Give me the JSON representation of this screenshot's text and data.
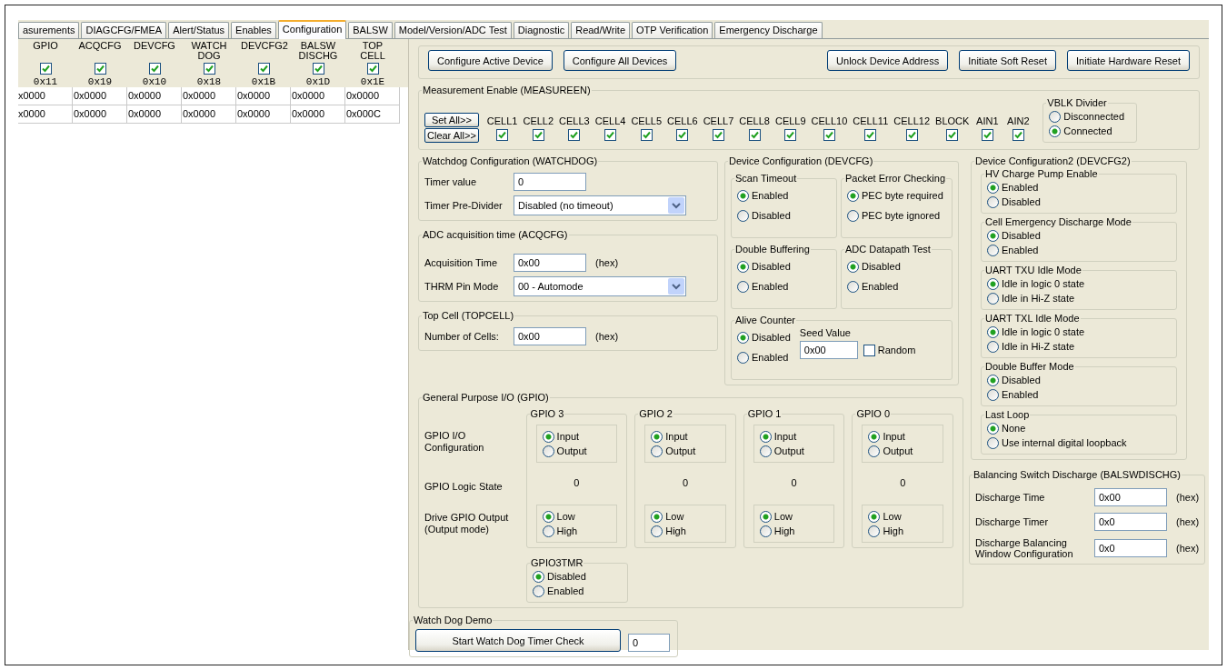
{
  "tabs": [
    {
      "label": "asurements",
      "selected": false
    },
    {
      "label": "DIAGCFG/FMEA",
      "selected": false
    },
    {
      "label": "Alert/Status",
      "selected": false
    },
    {
      "label": "Enables",
      "selected": false
    },
    {
      "label": "Configuration",
      "selected": true
    },
    {
      "label": "BALSW",
      "selected": false
    },
    {
      "label": "Model/Version/ADC Test",
      "selected": false
    },
    {
      "label": "Diagnostic",
      "selected": false
    },
    {
      "label": "Read/Write",
      "selected": false
    },
    {
      "label": "OTP Verification",
      "selected": false
    },
    {
      "label": "Emergency Discharge",
      "selected": false
    }
  ],
  "register_table": {
    "columns": [
      {
        "name": "GPIO",
        "checked": true,
        "address": "0x11"
      },
      {
        "name": "ACQCFG",
        "checked": true,
        "address": "0x19"
      },
      {
        "name": "DEVCFG",
        "checked": true,
        "address": "0x10"
      },
      {
        "name": "WATCH DOG",
        "checked": true,
        "address": "0x18"
      },
      {
        "name": "DEVCFG2",
        "checked": true,
        "address": "0x1B"
      },
      {
        "name": "BALSW DISCHG",
        "checked": true,
        "address": "0x1D"
      },
      {
        "name": "TOP CELL",
        "checked": true,
        "address": "0x1E"
      }
    ],
    "rows": [
      [
        "x0000",
        "0x0000",
        "0x0000",
        "0x0000",
        "0x0000",
        "0x0000",
        "0x0000"
      ],
      [
        "x0000",
        "0x0000",
        "0x0000",
        "0x0000",
        "0x0000",
        "0x0000",
        "0x000C"
      ]
    ]
  },
  "buttons": [
    "Configure Active Device",
    "Configure All Devices",
    "Unlock Device Address",
    "Initiate Soft Reset",
    "Initiate Hardware Reset"
  ],
  "measurement_enable": {
    "title": "Measurement Enable (MEASUREEN)",
    "set_all": "Set All>>",
    "clear_all": "Clear All>>",
    "channels": [
      {
        "label": "CELL1",
        "checked": true
      },
      {
        "label": "CELL2",
        "checked": true
      },
      {
        "label": "CELL3",
        "checked": true
      },
      {
        "label": "CELL4",
        "checked": true
      },
      {
        "label": "CELL5",
        "checked": true
      },
      {
        "label": "CELL6",
        "checked": true
      },
      {
        "label": "CELL7",
        "checked": true
      },
      {
        "label": "CELL8",
        "checked": true
      },
      {
        "label": "CELL9",
        "checked": true
      },
      {
        "label": "CELL10",
        "checked": true
      },
      {
        "label": "CELL11",
        "checked": true
      },
      {
        "label": "CELL12",
        "checked": true
      },
      {
        "label": "BLOCK",
        "checked": true
      },
      {
        "label": "AIN1",
        "checked": true
      },
      {
        "label": "AIN2",
        "checked": true
      }
    ],
    "vblk_divider": {
      "title": "VBLK Divider",
      "options": [
        {
          "label": "Disconnected",
          "selected": false
        },
        {
          "label": "Connected",
          "selected": true
        }
      ]
    }
  },
  "watchdog": {
    "title": "Watchdog Configuration (WATCHDOG)",
    "fields": [
      {
        "kind": "text",
        "label": "Timer value",
        "value": "0"
      },
      {
        "kind": "select",
        "label": "Timer Pre-Divider",
        "value": "Disabled (no timeout)"
      }
    ]
  },
  "acqcfg": {
    "title": "ADC acquisition time (ACQCFG)",
    "fields": [
      {
        "kind": "text",
        "label": "Acquisition Time",
        "value": "0x00",
        "unit": "(hex)"
      },
      {
        "kind": "select",
        "label": "THRM Pin Mode",
        "value": "00 - Automode"
      }
    ]
  },
  "topcell": {
    "title": "Top Cell (TOPCELL)",
    "fields": [
      {
        "kind": "text",
        "label": "Number of Cells:",
        "value": "0x00",
        "unit": "(hex)"
      }
    ]
  },
  "devcfg": {
    "title": "Device Configuration (DEVCFG)",
    "groups": [
      {
        "title": "Scan Timeout",
        "options": [
          {
            "label": "Enabled",
            "selected": true
          },
          {
            "label": "Disabled",
            "selected": false
          }
        ]
      },
      {
        "title": "Packet Error Checking",
        "options": [
          {
            "label": "PEC byte required",
            "selected": true
          },
          {
            "label": "PEC byte ignored",
            "selected": false
          }
        ]
      },
      {
        "title": "Double Buffering",
        "options": [
          {
            "label": "Disabled",
            "selected": true
          },
          {
            "label": "Enabled",
            "selected": false
          }
        ]
      },
      {
        "title": "ADC Datapath Test",
        "options": [
          {
            "label": "Disabled",
            "selected": true
          },
          {
            "label": "Enabled",
            "selected": false
          }
        ]
      }
    ],
    "alive_counter": {
      "title": "Alive Counter",
      "options": [
        {
          "label": "Disabled",
          "selected": true
        },
        {
          "label": "Enabled",
          "selected": false
        }
      ],
      "seed_label": "Seed Value",
      "seed_value": "0x00",
      "random": {
        "label": "Random",
        "checked": false
      }
    }
  },
  "devcfg2": {
    "title": "Device Configuration2 (DEVCFG2)",
    "groups": [
      {
        "title": "HV Charge Pump Enable",
        "options": [
          {
            "label": "Enabled",
            "selected": true
          },
          {
            "label": "Disabled",
            "selected": false
          }
        ]
      },
      {
        "title": "Cell Emergency Discharge Mode",
        "options": [
          {
            "label": "Disabled",
            "selected": true
          },
          {
            "label": "Enabled",
            "selected": false
          }
        ]
      },
      {
        "title": "UART TXU Idle Mode",
        "options": [
          {
            "label": "Idle in logic 0 state",
            "selected": true
          },
          {
            "label": "Idle in Hi-Z state",
            "selected": false
          }
        ]
      },
      {
        "title": "UART TXL Idle Mode",
        "options": [
          {
            "label": "Idle in logic 0 state",
            "selected": true
          },
          {
            "label": "Idle in Hi-Z state",
            "selected": false
          }
        ]
      },
      {
        "title": "Double Buffer Mode",
        "options": [
          {
            "label": "Disabled",
            "selected": true
          },
          {
            "label": "Enabled",
            "selected": false
          }
        ]
      },
      {
        "title": "Last Loop",
        "options": [
          {
            "label": "None",
            "selected": true
          },
          {
            "label": "Use internal digital loopback",
            "selected": false
          }
        ]
      }
    ]
  },
  "gpio": {
    "title": "General Purpose I/O (GPIO)",
    "row_labels": [
      "GPIO I/O Configuration",
      "GPIO Logic State",
      "Drive GPIO Output (Output mode)"
    ],
    "pins": [
      {
        "title": "GPIO 3",
        "io": [
          {
            "label": "Input",
            "selected": true
          },
          {
            "label": "Output",
            "selected": false
          }
        ],
        "logic_state": "0",
        "drive": [
          {
            "label": "Low",
            "selected": true
          },
          {
            "label": "High",
            "selected": false
          }
        ]
      },
      {
        "title": "GPIO 2",
        "io": [
          {
            "label": "Input",
            "selected": true
          },
          {
            "label": "Output",
            "selected": false
          }
        ],
        "logic_state": "0",
        "drive": [
          {
            "label": "Low",
            "selected": true
          },
          {
            "label": "High",
            "selected": false
          }
        ]
      },
      {
        "title": "GPIO 1",
        "io": [
          {
            "label": "Input",
            "selected": true
          },
          {
            "label": "Output",
            "selected": false
          }
        ],
        "logic_state": "0",
        "drive": [
          {
            "label": "Low",
            "selected": true
          },
          {
            "label": "High",
            "selected": false
          }
        ]
      },
      {
        "title": "GPIO 0",
        "io": [
          {
            "label": "Input",
            "selected": true
          },
          {
            "label": "Output",
            "selected": false
          }
        ],
        "logic_state": "0",
        "drive": [
          {
            "label": "Low",
            "selected": true
          },
          {
            "label": "High",
            "selected": false
          }
        ]
      }
    ],
    "gpio3tmr": {
      "title": "GPIO3TMR",
      "options": [
        {
          "label": "Disabled",
          "selected": true
        },
        {
          "label": "Enabled",
          "selected": false
        }
      ]
    }
  },
  "balswdischg": {
    "title": "Balancing Switch Discharge (BALSWDISCHG)",
    "fields": [
      {
        "kind": "text",
        "label": "Discharge Time",
        "value": "0x00",
        "unit": "(hex)"
      },
      {
        "kind": "text",
        "label": "Discharge Timer",
        "value": "0x0",
        "unit": "(hex)"
      },
      {
        "kind": "text",
        "label": "Discharge Balancing Window Configuration",
        "value": "0x0",
        "unit": "(hex)"
      }
    ]
  },
  "watchdog_demo": {
    "title": "Watch Dog Demo",
    "button": "Start Watch Dog Timer Check",
    "value": "0"
  }
}
